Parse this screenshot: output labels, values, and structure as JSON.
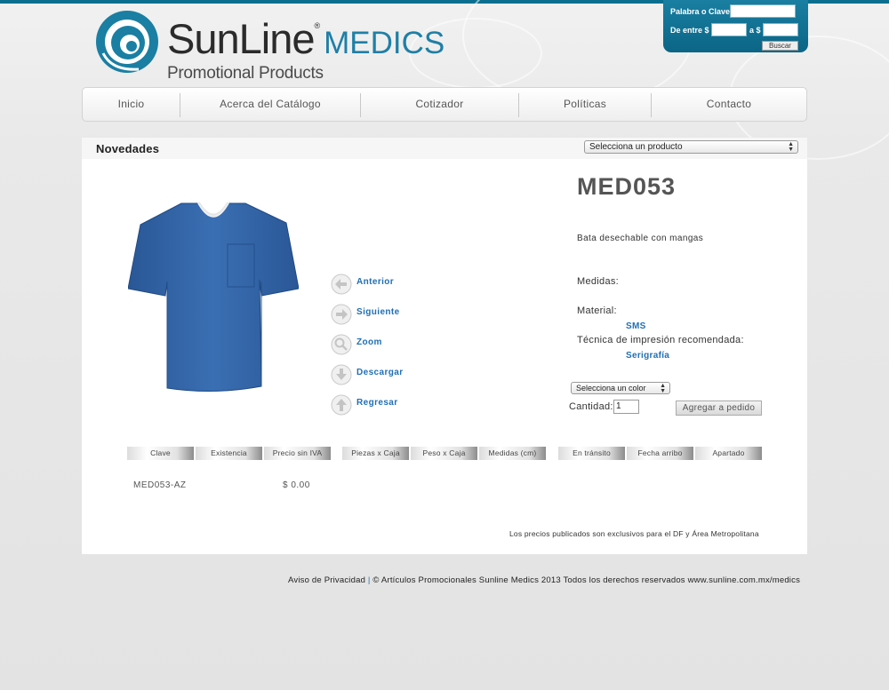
{
  "brand": {
    "name_part1": "SunLine",
    "registered": "®",
    "name_part2": "MEDICS",
    "tagline": "Promotional Products"
  },
  "search": {
    "keyword_label": "Palabra o Clave:",
    "keyword_value": "",
    "range_label": "De entre $",
    "range_to_label": "a $",
    "min_value": "",
    "max_value": "",
    "button_label": "Buscar"
  },
  "nav": {
    "items": [
      {
        "label": "Inicio"
      },
      {
        "label": "Acerca del Catálogo"
      },
      {
        "label": "Cotizador"
      },
      {
        "label": "Políticas"
      },
      {
        "label": "Contacto"
      }
    ]
  },
  "section": {
    "title": "Novedades",
    "product_select": "Selecciona un producto"
  },
  "actions": [
    {
      "label": "Anterior",
      "icon": "arrow-left-icon"
    },
    {
      "label": "Siguiente",
      "icon": "arrow-right-icon"
    },
    {
      "label": "Zoom",
      "icon": "zoom-icon"
    },
    {
      "label": "Descargar",
      "icon": "download-icon"
    },
    {
      "label": "Regresar",
      "icon": "arrow-up-icon"
    }
  ],
  "product": {
    "code": "MED053",
    "description": "Bata desechable con mangas",
    "medidas_label": "Medidas:",
    "material_label": "Material:",
    "material_value": "SMS",
    "tecnica_label": "Técnica de impresión recomendada:",
    "tecnica_value": "Serigrafía",
    "color_select": "Selecciona un color",
    "cantidad_label": "Cantidad:",
    "cantidad_value": "1",
    "add_button": "Agregar a pedido",
    "garment_color": "#2f5f9e"
  },
  "table": {
    "headers": [
      "Clave",
      "Existencia",
      "Precio sin IVA",
      "Piezas x Caja",
      "Peso x Caja",
      "Medidas (cm)",
      "En tránsito",
      "Fecha arribo",
      "Apartado"
    ],
    "row": {
      "clave": "MED053-AZ",
      "precio": "$ 0.00"
    }
  },
  "note": "Los precios publicados son exclusivos para el DF y Área Metropolitana",
  "footer": {
    "privacy": "Aviso de Privacidad",
    "separator": "|",
    "copyright": "© Artículos Promocionales Sunline Medics 2013 Todos los derechos reservados www.sunline.com.mx/medics"
  },
  "colors": {
    "accent": "#1f7fa6",
    "link": "#1f6fb5",
    "topbar": "#0a6f8f"
  }
}
